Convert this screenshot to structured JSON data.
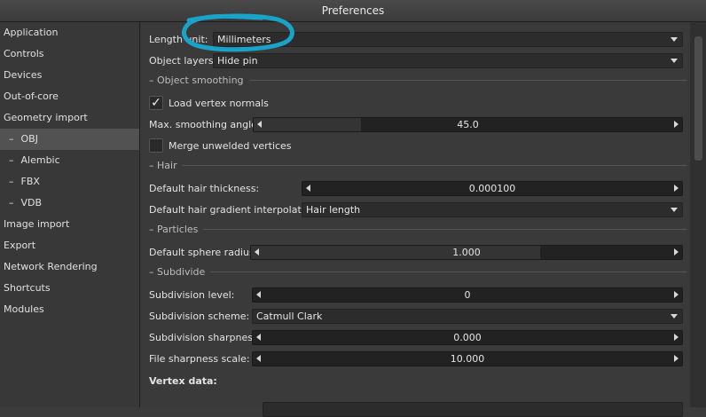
{
  "window": {
    "title": "Preferences"
  },
  "sidebar": {
    "items": [
      {
        "label": "Application",
        "sub": false,
        "selected": false
      },
      {
        "label": "Controls",
        "sub": false,
        "selected": false
      },
      {
        "label": "Devices",
        "sub": false,
        "selected": false
      },
      {
        "label": "Out-of-core",
        "sub": false,
        "selected": false
      },
      {
        "label": "Geometry import",
        "sub": false,
        "selected": false
      },
      {
        "label": "OBJ",
        "sub": true,
        "selected": true
      },
      {
        "label": "Alembic",
        "sub": true,
        "selected": false
      },
      {
        "label": "FBX",
        "sub": true,
        "selected": false
      },
      {
        "label": "VDB",
        "sub": true,
        "selected": false
      },
      {
        "label": "Image import",
        "sub": false,
        "selected": false
      },
      {
        "label": "Export",
        "sub": false,
        "selected": false
      },
      {
        "label": "Network Rendering",
        "sub": false,
        "selected": false
      },
      {
        "label": "Shortcuts",
        "sub": false,
        "selected": false
      },
      {
        "label": "Modules",
        "sub": false,
        "selected": false
      }
    ],
    "dash": "–"
  },
  "main": {
    "length_unit": {
      "label": "Length unit:",
      "value": "Millimeters"
    },
    "object_layers": {
      "label": "Object layers:",
      "value": "Hide pin"
    },
    "section_smoothing": "Object smoothing",
    "load_vertex_normals": {
      "label": "Load vertex normals",
      "checked": true,
      "check": "✓"
    },
    "max_smoothing_angle": {
      "label": "Max. smoothing angle:",
      "value": "45.0",
      "fraction": 0.25
    },
    "merge_unwelded": {
      "label": "Merge unwelded vertices",
      "checked": false
    },
    "section_hair": "Hair",
    "default_hair_thickness": {
      "label": "Default hair thickness:",
      "value": "0.000100",
      "fraction": 0.0
    },
    "hair_gradient": {
      "label": "Default hair gradient interpolation:",
      "value": "Hair length"
    },
    "section_particles": "Particles",
    "sphere_radius": {
      "label": "Default sphere radius:",
      "value": "1.000",
      "fraction": 0.67
    },
    "section_subdivide": "Subdivide",
    "subdivision_level": {
      "label": "Subdivision level:",
      "value": "0",
      "fraction": 0.0
    },
    "subdivision_scheme": {
      "label": "Subdivision scheme:",
      "value": "Catmull Clark"
    },
    "subdivision_sharpness": {
      "label": "Subdivision sharpness:",
      "value": "0.000",
      "fraction": 0.0
    },
    "file_sharpness_scale": {
      "label": "File sharpness scale:",
      "value": "10.000",
      "fraction": 0.0
    },
    "vertex_data": "Vertex data:",
    "section_dash": "–"
  },
  "annotation": {
    "color": "#1aa3c8"
  }
}
